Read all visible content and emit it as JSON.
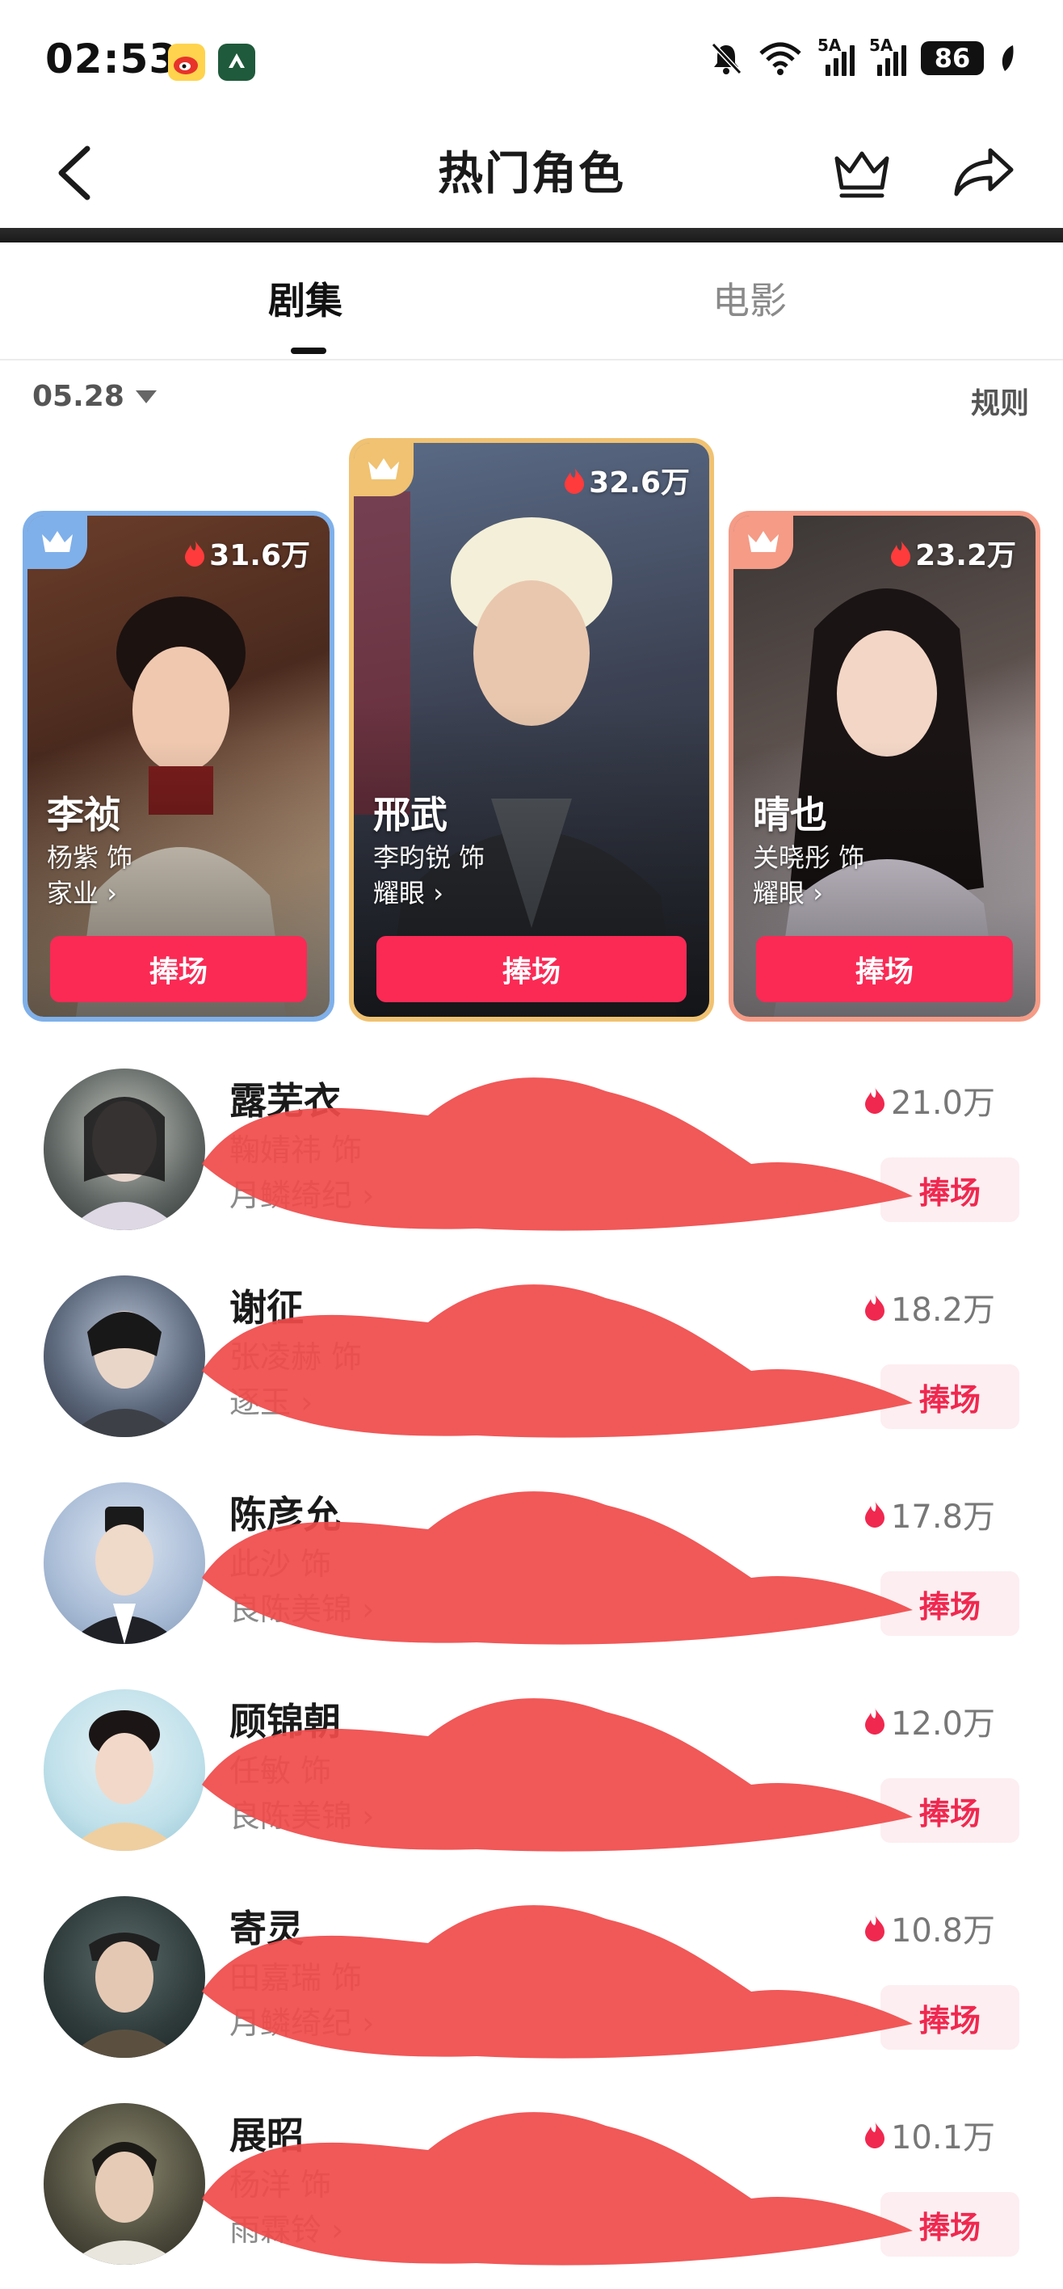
{
  "status_bar": {
    "time": "02:53",
    "signal_label": "5A",
    "battery": "86"
  },
  "header": {
    "title": "热门角色"
  },
  "tabs": [
    {
      "label": "剧集"
    },
    {
      "label": "电影"
    }
  ],
  "date_selector": {
    "value": "05.28"
  },
  "rules_link": "规则",
  "podium": [
    {
      "rank": 2,
      "heat": "31.6万",
      "name": "李祯",
      "actor": "杨紫 饰",
      "show": "家业",
      "button": "捧场",
      "theme_color": "#7fb0ea"
    },
    {
      "rank": 1,
      "heat": "32.6万",
      "name": "邢武",
      "actor": "李昀锐 饰",
      "show": "耀眼",
      "button": "捧场",
      "theme_color": "#f0c271"
    },
    {
      "rank": 3,
      "heat": "23.2万",
      "name": "晴也",
      "actor": "关晓彤 饰",
      "show": "耀眼",
      "button": "捧场",
      "theme_color": "#f59b86"
    }
  ],
  "list": [
    {
      "name": "露芜衣",
      "actor": "鞠婧祎 饰",
      "show": "月鳞绮纪",
      "heat": "21.0万",
      "button": "捧场"
    },
    {
      "name": "谢征",
      "actor": "张凌赫 饰",
      "show": "逐玉",
      "heat": "18.2万",
      "button": "捧场"
    },
    {
      "name": "陈彦允",
      "actor": "此沙 饰",
      "show": "良陈美锦",
      "heat": "17.8万",
      "button": "捧场"
    },
    {
      "name": "顾锦朝",
      "actor": "任敏 饰",
      "show": "良陈美锦",
      "heat": "12.0万",
      "button": "捧场"
    },
    {
      "name": "寄灵",
      "actor": "田嘉瑞 饰",
      "show": "月鳞绮纪",
      "heat": "10.8万",
      "button": "捧场"
    },
    {
      "name": "展昭",
      "actor": "杨洋 饰",
      "show": "雨霖铃",
      "heat": "10.1万",
      "button": "捧场"
    }
  ],
  "colors": {
    "accent": "#fa2a55",
    "accent_light": "#fdeef1",
    "heat_icon": "#f0284f",
    "redaction": "#f04a4a"
  }
}
